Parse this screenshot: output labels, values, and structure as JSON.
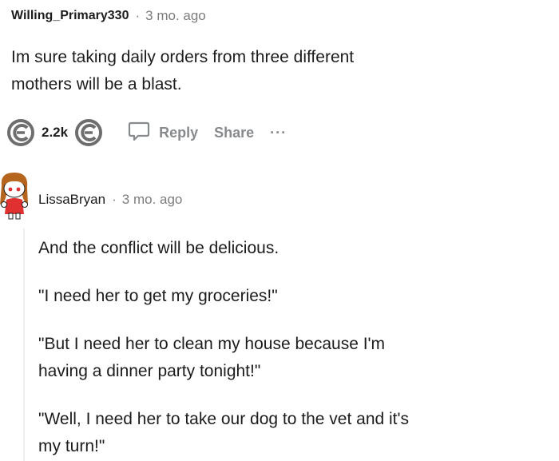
{
  "comment": {
    "username": "Willing_Primary330",
    "separator": "·",
    "time": "3 mo. ago",
    "body": "Im sure taking daily orders from three different mothers will be a blast.",
    "body_line1": "Im sure taking daily orders from three different",
    "body_line2": "mothers will be a blast."
  },
  "actions": {
    "upvote_icon": "upvote-icon",
    "score": "2.2k",
    "downvote_icon": "downvote-icon",
    "reply_icon": "speech-bubble-icon",
    "reply_label": "Reply",
    "share_label": "Share",
    "more_label": "···"
  },
  "reply": {
    "username": "LissaBryan",
    "separator": "·",
    "time": "3 mo. ago",
    "avatar_icon": "snoo-avatar",
    "paragraphs": [
      "And the conflict will be delicious.",
      "\"I need her to get my groceries!\"",
      "\"But I need her to clean my house because I'm having a dinner party tonight!\"",
      "\"Well, I need her to take our dog to the vet and it's my turn!\""
    ],
    "p3_line1": "\"But I need her to clean my house because I'm",
    "p3_line2": "having a dinner party tonight!\"",
    "p4_line1": "\"Well, I need her to take our dog to the vet and it's",
    "p4_line2": "my turn!\""
  },
  "colors": {
    "text": "#1c1c1c",
    "meta": "#7c7c7c",
    "action": "#878a8c",
    "thread_line": "#edeff1",
    "avatar_hair": "#b5651d",
    "avatar_shirt": "#e0302f"
  }
}
